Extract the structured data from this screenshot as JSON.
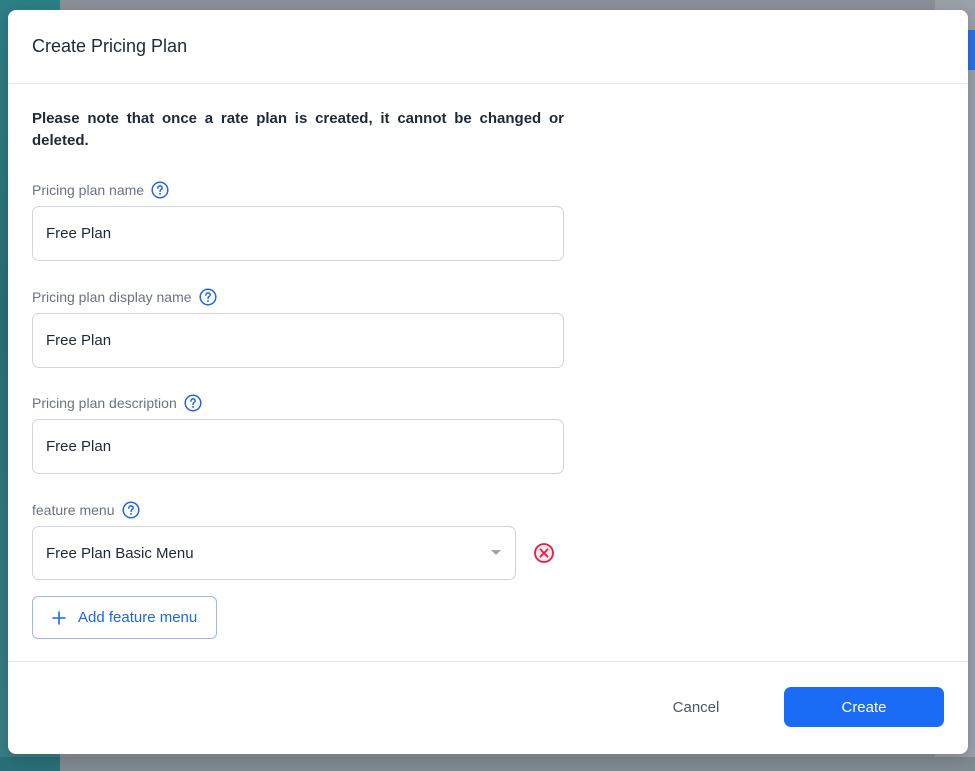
{
  "modal": {
    "title": "Create Pricing Plan",
    "notice": "Please note that once a rate plan is created, it cannot be changed or deleted."
  },
  "fields": {
    "plan_name": {
      "label": "Pricing plan name",
      "value": "Free Plan",
      "icon": "question-circle-icon"
    },
    "display_name": {
      "label": "Pricing plan display name",
      "value": "Free Plan",
      "icon": "question-circle-icon"
    },
    "description": {
      "label": "Pricing plan description",
      "value": "Free Plan",
      "icon": "question-circle-icon"
    },
    "feature_menu": {
      "label": "feature menu",
      "selected": "Free Plan Basic Menu",
      "icon": "question-circle-icon",
      "remove_icon": "remove-circle-icon"
    }
  },
  "actions": {
    "add_feature_menu": "Add feature menu",
    "cancel": "Cancel",
    "create": "Create"
  },
  "colors": {
    "primary": "#1a6cf6",
    "help_icon": "#1e66e8",
    "danger": "#e11d48",
    "text": "#1f2937",
    "label": "#6b7280",
    "border": "#cfd4da"
  }
}
